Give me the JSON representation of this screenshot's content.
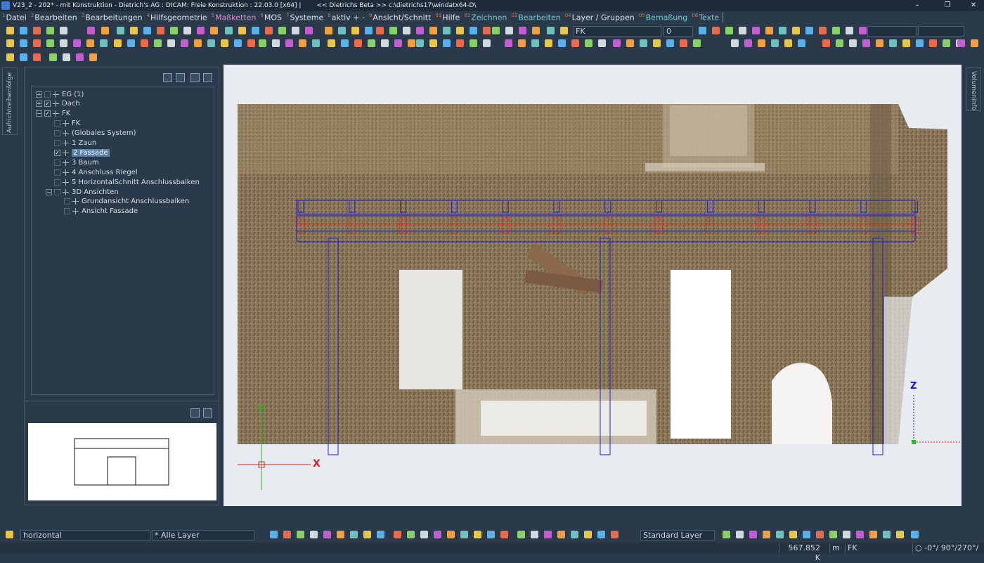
{
  "window": {
    "title": "V23_2 - 202* - mit Konstruktion - Dietrich's AG : DICAM: Freie Konstruktion : 22.03.0 [x64] |",
    "path": "<< Dietrichs Beta >> c:\\dietrichs17\\windatx64-D\\",
    "minimize": "–",
    "restore": "❐",
    "close": "✕"
  },
  "menu": [
    {
      "num": "1",
      "label": "Datei",
      "style": "normal"
    },
    {
      "num": "2",
      "label": "Bearbeiten",
      "style": "normal"
    },
    {
      "num": "3",
      "label": "Bearbeitungen",
      "style": "normal"
    },
    {
      "num": "4",
      "label": "Hilfsgeometrie",
      "style": "normal"
    },
    {
      "num": "5",
      "label": "Maßketten",
      "style": "pink"
    },
    {
      "num": "6",
      "label": "MOS",
      "style": "normal"
    },
    {
      "num": "7",
      "label": "Systeme",
      "style": "normal"
    },
    {
      "num": "8",
      "label": "aktiv + -",
      "style": "normal"
    },
    {
      "num": "9",
      "label": "Ansicht/Schnitt",
      "style": "normal"
    },
    {
      "num": "01",
      "label": "Hilfe",
      "style": "normal"
    },
    {
      "num": "02",
      "label": "Zeichnen",
      "style": "teal"
    },
    {
      "num": "03",
      "label": "Bearbeiten",
      "style": "teal"
    },
    {
      "num": "04",
      "label": "Layer / Gruppen",
      "style": "normal"
    },
    {
      "num": "05",
      "label": "Bemaßung",
      "style": "teal"
    },
    {
      "num": "06",
      "label": "Texte",
      "style": "teal"
    }
  ],
  "toolbar": {
    "layer_combo": "FK",
    "number_combo": "0"
  },
  "side_tabs": {
    "left": "Aufrichtreihenfolge",
    "right": "Volumeninfo"
  },
  "tree": [
    {
      "label": "EG (1)",
      "level": 0,
      "expander": "+",
      "checked": false,
      "selected": false
    },
    {
      "label": "Dach",
      "level": 0,
      "expander": "+",
      "checked": true,
      "selected": false
    },
    {
      "label": "FK",
      "level": 0,
      "expander": "−",
      "checked": true,
      "selected": false
    },
    {
      "label": "FK",
      "level": 1,
      "expander": "",
      "checked": false,
      "selected": false
    },
    {
      "label": "(Globales System)",
      "level": 1,
      "expander": "",
      "checked": false,
      "selected": false
    },
    {
      "label": "1 Zaun",
      "level": 1,
      "expander": "",
      "checked": false,
      "selected": false
    },
    {
      "label": "2 Fassade",
      "level": 1,
      "expander": "",
      "checked": true,
      "selected": true
    },
    {
      "label": "3 Baum",
      "level": 1,
      "expander": "",
      "checked": false,
      "selected": false
    },
    {
      "label": "4 Anschluss Riegel",
      "level": 1,
      "expander": "",
      "checked": false,
      "selected": false
    },
    {
      "label": "5 HorizontalSchnitt Anschlussbalken",
      "level": 1,
      "expander": "",
      "checked": false,
      "selected": false
    },
    {
      "label": "3D Ansichten",
      "level": 1,
      "expander": "−",
      "checked": false,
      "selected": false
    },
    {
      "label": "Grundansicht Anschlussbalken",
      "level": 2,
      "expander": "",
      "checked": false,
      "selected": false
    },
    {
      "label": "Ansicht Fassade",
      "level": 2,
      "expander": "",
      "checked": false,
      "selected": false
    }
  ],
  "viewport": {
    "axis_x": "X",
    "axis_y": "Y",
    "axis_z": "Z",
    "colors": {
      "construction": "#2020d0",
      "accent_red": "#e02020",
      "axis_green": "#20c020",
      "axis_blue": "#1010e0"
    }
  },
  "bottom": {
    "mode_combo": "horizontal",
    "layer_filter": "* Alle Layer",
    "standard_layer": "Standard Layer"
  },
  "status": {
    "memory": "567.852 K",
    "unit": "m",
    "layer": "FK",
    "angle": "-0°/ 90°/270°/"
  }
}
